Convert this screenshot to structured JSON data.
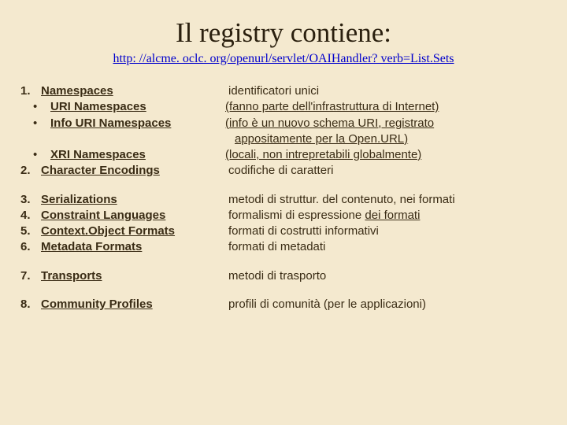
{
  "title": "Il registry contiene:",
  "url": "http: //alcme. oclc. org/openurl/servlet/OAIHandler? verb=List.Sets",
  "items": {
    "n1": {
      "num": "1.",
      "label": "Namespaces",
      "desc": "identificatori unici"
    },
    "n1a": {
      "bullet": "•",
      "label": "URI Namespaces",
      "desc": "(fanno parte dell'infrastruttura di Internet)"
    },
    "n1b": {
      "bullet": "•",
      "label": "Info URI Namespaces",
      "desc": "(info è un nuovo schema URI, registrato"
    },
    "n1b2": {
      "desc": "appositamente per la Open.URL)"
    },
    "n1c": {
      "bullet": "•",
      "label": "XRI Namespaces",
      "desc": "(locali, non intrepretabili globalmente)"
    },
    "n2": {
      "num": "2.",
      "label": "Character Encodings",
      "desc": "codifiche di caratteri"
    },
    "n3": {
      "num": "3.",
      "label": "Serializations",
      "desc": "metodi di struttur. del contenuto, nei formati"
    },
    "n4": {
      "num": "4.",
      "label": "Constraint Languages",
      "desc_pre": "formalismi di espressione ",
      "desc_u": "dei formati"
    },
    "n5": {
      "num": "5.",
      "label": "Context.Object Formats",
      "desc": "formati di costrutti informativi"
    },
    "n6": {
      "num": "6.",
      "label": "Metadata Formats",
      "desc": "formati di metadati"
    },
    "n7": {
      "num": "7.",
      "label": "Transports",
      "desc": "metodi di trasporto"
    },
    "n8": {
      "num": "8.",
      "label": "Community Profiles",
      "desc": "profili di comunità (per le applicazioni)"
    }
  }
}
